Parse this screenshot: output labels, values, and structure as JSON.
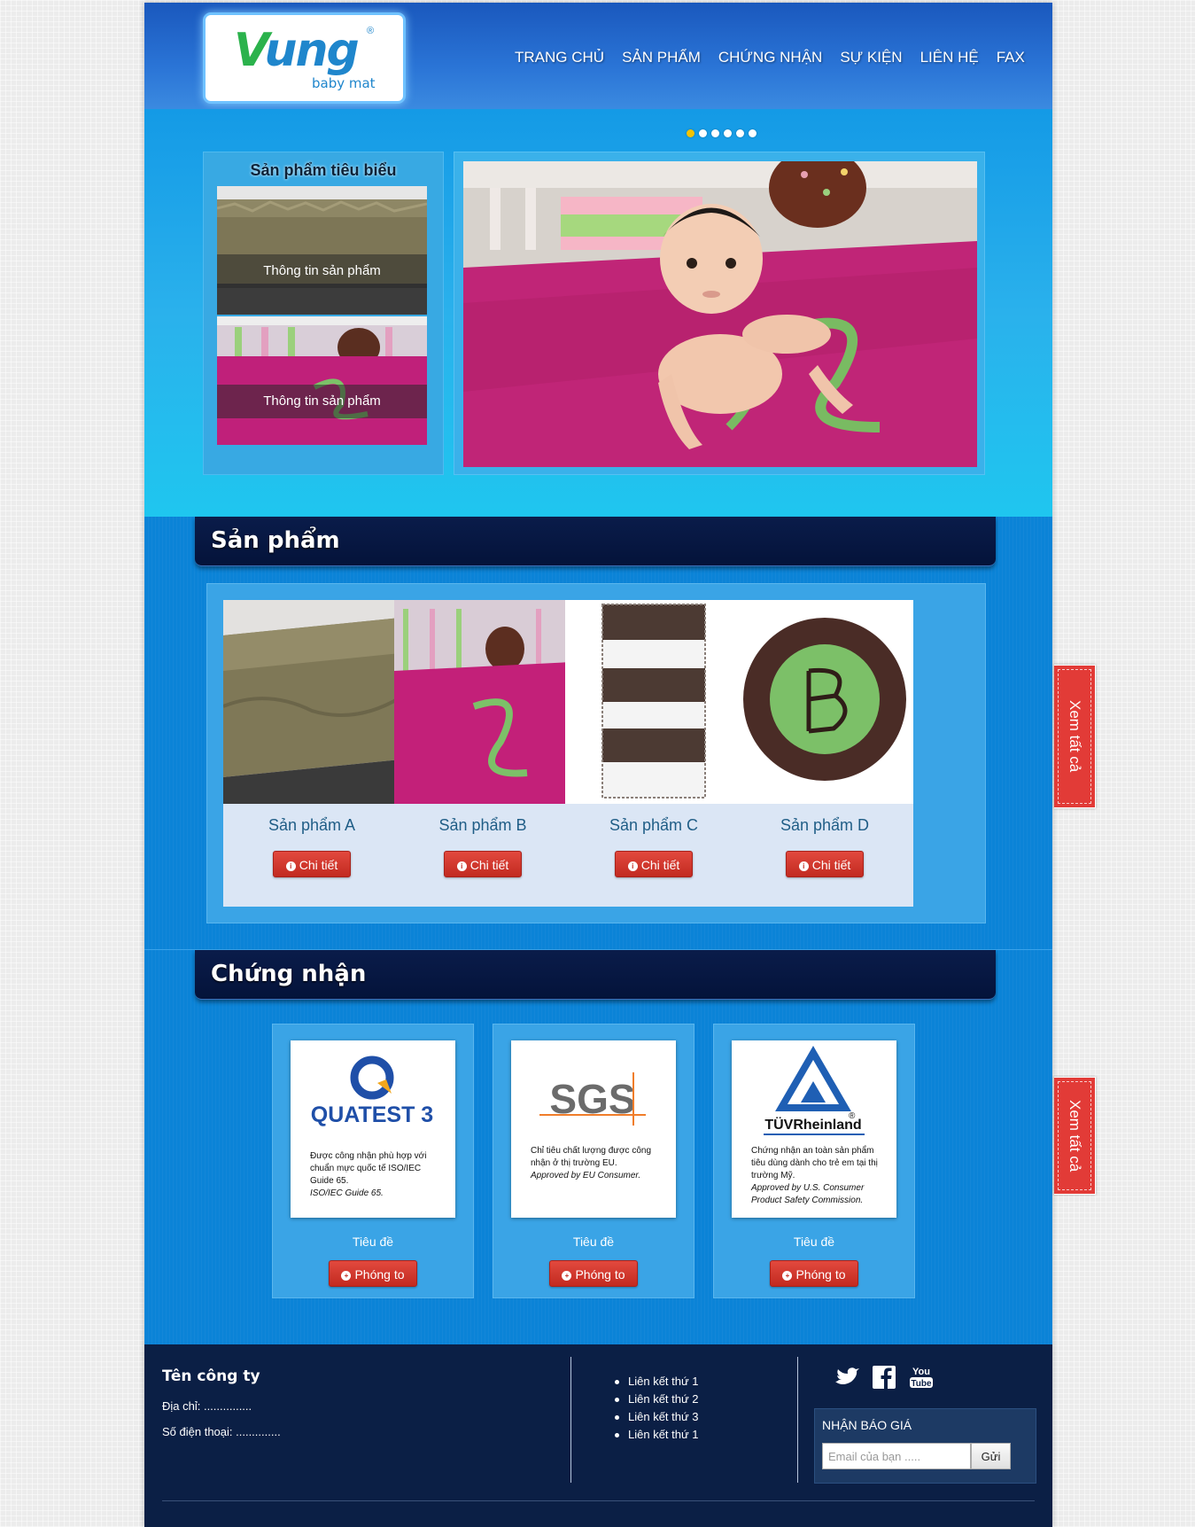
{
  "logo": {
    "main": "ung",
    "accent": "V",
    "registered": "®",
    "sub": "baby mat"
  },
  "nav": [
    {
      "label": "Trang chủ"
    },
    {
      "label": "Sản phẩm"
    },
    {
      "label": "Chứng nhận"
    },
    {
      "label": "Sự kiện"
    },
    {
      "label": "Liên hệ"
    },
    {
      "label": "FAX"
    }
  ],
  "slider": {
    "dot_count": 6,
    "active_dot": 1
  },
  "featured": {
    "title": "Sản phẩm tiêu biểu",
    "items": [
      {
        "caption": "Thông tin sản phẩm"
      },
      {
        "caption": "Thông tin sản phẩm"
      }
    ]
  },
  "products": {
    "title": "Sản phẩm",
    "items": [
      {
        "name": "Sản phẩm A",
        "button": "Chi tiết"
      },
      {
        "name": "Sản phẩm B",
        "button": "Chi tiết"
      },
      {
        "name": "Sản phẩm C",
        "button": "Chi tiết"
      },
      {
        "name": "Sản phẩm D",
        "button": "Chi tiết"
      }
    ]
  },
  "certs": {
    "title": "Chứng nhận",
    "items": [
      {
        "logo": "QUATEST 3",
        "desc1": "Được công nhận phù hợp với chuẩn mực quốc tế ISO/IEC Guide 65.",
        "desc2": "ISO/IEC Guide 65.",
        "title": "Tiêu đề",
        "button": "Phóng to"
      },
      {
        "logo": "SGS",
        "desc1": "Chỉ tiêu chất lượng được công nhận ở thị trường EU.",
        "desc2": "Approved by EU Consumer.",
        "title": "Tiêu đề",
        "button": "Phóng to"
      },
      {
        "logo": "TÜVRheinland",
        "desc1": "Chứng nhận an toàn sản phẩm tiêu dùng dành cho trẻ em tại thị trường Mỹ.",
        "desc2": "Approved by U.S. Consumer Product Safety Commission.",
        "title": "Tiêu đề",
        "button": "Phóng to"
      }
    ]
  },
  "side_tabs": [
    {
      "label": "Xem tất cả"
    },
    {
      "label": "Xem tất cả"
    }
  ],
  "footer": {
    "company": "Tên công ty",
    "address": "Địa chỉ: ...............",
    "phone": "Số điện thoại: ..............",
    "links": [
      "Liên kết thứ 1",
      "Liên kết thứ 2",
      "Liên kết thứ 3",
      "Liên kết thứ 1"
    ],
    "social": [
      "twitter-icon",
      "facebook-icon",
      "youtube-icon"
    ],
    "youtube_text": [
      "You",
      "Tube"
    ],
    "quote_title": "NHẬN BÁO GIÁ",
    "email_placeholder": "Email của bạn .....",
    "submit": "Gửi"
  },
  "colors": {
    "brand_blue": "#0d82d8",
    "header_blue": "#1a58bd",
    "button_red": "#c22a20",
    "footer_navy": "#0b1f45",
    "accent_yellow": "#f3c300"
  }
}
